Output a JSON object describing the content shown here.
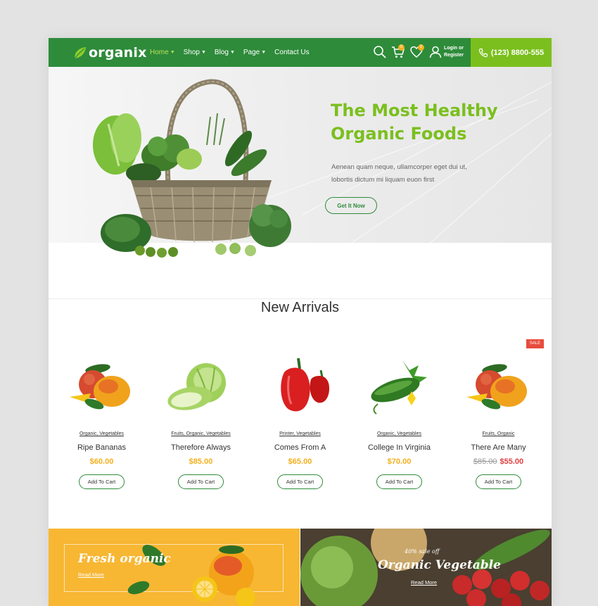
{
  "header": {
    "logo": "organix",
    "nav": [
      {
        "label": "Home",
        "caret": true,
        "active": true
      },
      {
        "label": "Shop",
        "caret": true
      },
      {
        "label": "Blog",
        "caret": true
      },
      {
        "label": "Page",
        "caret": true
      },
      {
        "label": "Contact Us",
        "caret": false
      }
    ],
    "cart_count": "0",
    "wishlist_count": "0",
    "login_line1": "Login or",
    "login_line2": "Register",
    "phone": "(123) 8800-555"
  },
  "hero": {
    "title_line1": "The Most Healthy",
    "title_line2": "Organic Foods",
    "text_line1": "Aenean quam neque, ullamcorper eget dui ut,",
    "text_line2": "lobortis dictum mi liquam euon first",
    "button": "Get It Now"
  },
  "arrivals": {
    "title": "New Arrivals",
    "sale_badge": "SALE",
    "products": [
      {
        "cats": "Organic, Vegetables",
        "name": "Ripe Bananas",
        "price": "$60.00",
        "old_price": "",
        "image": "apple-mango"
      },
      {
        "cats": "Fruits, Organic, Vegetables",
        "name": "Therefore Always",
        "price": "$85.00",
        "old_price": "",
        "image": "cabbage"
      },
      {
        "cats": "Printer, Vegetables",
        "name": "Comes From A",
        "price": "$65.00",
        "old_price": "",
        "image": "red-peppers"
      },
      {
        "cats": "Organic, Vegetables",
        "name": "College In Virginia",
        "price": "$70.00",
        "old_price": "",
        "image": "cucumber"
      },
      {
        "cats": "Fruits, Organic",
        "name": "There Are Many",
        "price": "$55.00",
        "old_price": "$85.00",
        "image": "apple-mango"
      }
    ],
    "add_to_cart": "Add To Cart"
  },
  "banners": {
    "left_title": "Fresh organic",
    "left_link": "Read More",
    "right_sub": "40% sale off",
    "right_title": "Organic Vegetable",
    "right_link": "Read More"
  },
  "colors": {
    "header_green": "#2e8b3a",
    "accent_lime": "#7bbf1e",
    "price_orange": "#f2b01e",
    "sale_red": "#e74c3c"
  }
}
